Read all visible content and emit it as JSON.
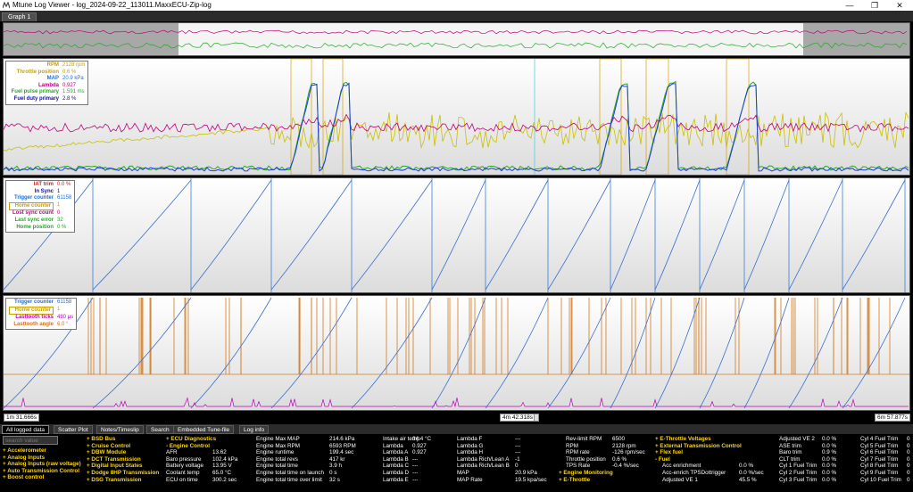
{
  "window": {
    "title": "Mtune Log Viewer - log_2024-09-22_113011.MaxxECU-Zip-log",
    "minimize_glyph": "—",
    "restore_glyph": "❐",
    "close_glyph": "✕"
  },
  "graph_tabs": [
    "Graph 1"
  ],
  "panel1_legend": [
    {
      "name": "RPM",
      "value": "2128 rpm",
      "color": "#c8a000"
    },
    {
      "name": "Throttle position",
      "value": "0.6 %",
      "color": "#c8a000"
    },
    {
      "name": "MAP",
      "value": "20.9 kPa",
      "color": "#1e6fd9"
    },
    {
      "name": "Lambda",
      "value": "0.927",
      "color": "#c0007a"
    },
    {
      "name": "Fuel pulse primary",
      "value": "1.591 ms",
      "color": "#22aa22"
    },
    {
      "name": "Fuel duty primary",
      "value": "2.8 %",
      "color": "#1010a0"
    }
  ],
  "panel2_legend": [
    {
      "name": "IAT trim",
      "value": "0.0 %",
      "color": "#d42020"
    },
    {
      "name": "In Sync",
      "value": "1",
      "color": "#1010a0"
    },
    {
      "name": "Trigger counter",
      "value": "61158",
      "color": "#1e6fd9"
    },
    {
      "name": "Home counter",
      "value": "1",
      "color": "#c8a000",
      "boxed": true
    },
    {
      "name": "Lost sync count",
      "value": "0",
      "color": "#c0007a"
    },
    {
      "name": "Last sync error",
      "value": "32",
      "color": "#22aa22"
    },
    {
      "name": "Home position",
      "value": "0 %",
      "color": "#22aa22"
    }
  ],
  "panel3_legend": [
    {
      "name": "Trigger counter",
      "value": "61158",
      "color": "#1e6fd9"
    },
    {
      "name": "Home counter",
      "value": "1",
      "color": "#c8a000",
      "boxed": true
    },
    {
      "name": "Lasttooth ticks",
      "value": "480 µs",
      "color": "#c000c0"
    },
    {
      "name": "Lasttooth angle",
      "value": "6.0 °",
      "color": "#d07020"
    }
  ],
  "timeline": {
    "start": "1m 31.666s",
    "cursor": "4m 42.318s",
    "end": "6m 57.877s"
  },
  "bottom_tabs": [
    "All logged data",
    "Scatter Plot",
    "Notes/Timeslip",
    "Search",
    "Embedded Tune-file",
    "Log info"
  ],
  "search": {
    "placeholder": "search value"
  },
  "categories_col1": [
    "+ Accelerometer",
    "+ Analog Inputs",
    "+ Analog Inputs (raw voltage)",
    "+ Auto Transmission Control",
    "+ Boost control"
  ],
  "categories_col2": [
    "+ BSD Bus",
    "+ Cruise Control",
    "+ DBW Module",
    "+ DCT Transmission",
    "+ Digital Input States",
    "+ Dodge 8HP Transmission",
    "+ DSG Transmission"
  ],
  "col3": {
    "headers": [
      "+ ECU Diagnostics",
      "- Engine Control"
    ],
    "rows": [
      {
        "k": "AFR",
        "v": "13.62"
      },
      {
        "k": "Baro pressure",
        "v": "102.4 kPa"
      },
      {
        "k": "Battery voltage",
        "v": "13.95 V"
      },
      {
        "k": "Coolant temp",
        "v": "65.0 °C"
      },
      {
        "k": "ECU on time",
        "v": "300.2 sec"
      }
    ]
  },
  "col4": [
    {
      "k": "Engine Max MAP",
      "v": "214.6 kPa"
    },
    {
      "k": "Engine Max RPM",
      "v": "6593 RPM"
    },
    {
      "k": "Engine runtime",
      "v": "199.4 sec"
    },
    {
      "k": "Engine total revs",
      "v": "417 kr"
    },
    {
      "k": "Engine total time",
      "v": "3.9 h"
    },
    {
      "k": "Engine total time on launch",
      "v": "0 s"
    },
    {
      "k": "Engine total time over limit",
      "v": "32 s"
    }
  ],
  "col5": [
    {
      "k": "Intake air temp",
      "v": "34.4 °C"
    },
    {
      "k": "Lambda",
      "v": "0.927"
    },
    {
      "k": "Lambda A",
      "v": "0.927"
    },
    {
      "k": "Lambda B",
      "v": "---"
    },
    {
      "k": "Lambda C",
      "v": "---"
    },
    {
      "k": "Lambda D",
      "v": "---"
    },
    {
      "k": "Lambda E",
      "v": "---"
    }
  ],
  "col6": [
    {
      "k": "Lambda F",
      "v": "---"
    },
    {
      "k": "Lambda G",
      "v": "---"
    },
    {
      "k": "Lambda H",
      "v": "---"
    },
    {
      "k": "Lambda Rich/Lean A",
      "v": "-1"
    },
    {
      "k": "Lambda Rich/Lean B",
      "v": "0"
    },
    {
      "k": "MAP",
      "v": "20.9 kPa"
    },
    {
      "k": "MAP Rate",
      "v": "19.5 kpa/sec"
    }
  ],
  "col7": {
    "rows": [
      {
        "k": "Rev-limit RPM",
        "v": "6500"
      },
      {
        "k": "RPM",
        "v": "2128 rpm"
      },
      {
        "k": "RPM rate",
        "v": "-126 rpm/sec"
      },
      {
        "k": "Throttle position",
        "v": "0.6 %"
      },
      {
        "k": "TPS Rate",
        "v": "-0.4 %/sec"
      }
    ],
    "headers": [
      "+ Engine Monitoring",
      "+ E-Throttle"
    ]
  },
  "col8": {
    "headers": [
      "+ E-Throttle Voltages",
      "+ External Transmission Control",
      "+ Flex fuel",
      "- Fuel"
    ],
    "rows": [
      {
        "k": "Acc enrichment",
        "v": "0.0 %"
      },
      {
        "k": "Acc-enrich TPSDottrigger",
        "v": "0.0 %/sec"
      },
      {
        "k": "Adjusted VE 1",
        "v": "45.5 %"
      }
    ]
  },
  "col9": [
    {
      "k": "Adjusted VE 2",
      "v": "0.0 %"
    },
    {
      "k": "ASE trim",
      "v": "0.0 %"
    },
    {
      "k": "Baro trim",
      "v": "0.9 %"
    },
    {
      "k": "CLT trim",
      "v": "0.0 %"
    },
    {
      "k": "Cyl 1 Fuel Trim",
      "v": "0.0 %"
    },
    {
      "k": "Cyl 2 Fuel Trim",
      "v": "0.0 %"
    },
    {
      "k": "Cyl 3 Fuel Trim",
      "v": "0.0 %"
    }
  ],
  "col10": [
    {
      "k": "Cyl 4 Fuel Trim",
      "v": "0"
    },
    {
      "k": "Cyl 5 Fuel Trim",
      "v": "0"
    },
    {
      "k": "Cyl 6 Fuel Trim",
      "v": "0"
    },
    {
      "k": "Cyl 7 Fuel Trim",
      "v": "0"
    },
    {
      "k": "Cyl 8 Fuel Trim",
      "v": "0"
    },
    {
      "k": "Cyl 9 Fuel Trim",
      "v": "0"
    },
    {
      "k": "Cyl 10 Fuel Trim",
      "v": "0"
    }
  ]
}
